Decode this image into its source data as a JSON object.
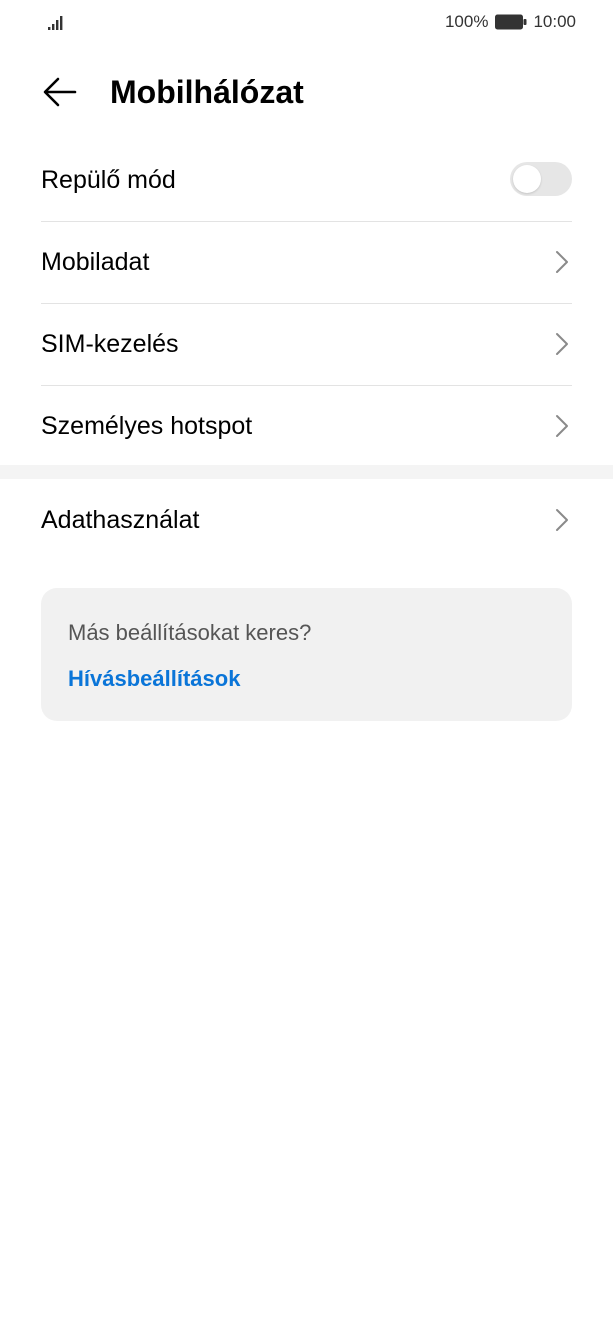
{
  "status_bar": {
    "signal_icon": "signal-icon",
    "battery_percent": "100%",
    "battery_icon": "battery-icon",
    "time": "10:00"
  },
  "header": {
    "back_icon": "arrow-left-icon",
    "title": "Mobilhálózat"
  },
  "settings": {
    "items": [
      {
        "label": "Repülő mód",
        "control": "toggle",
        "toggle_on": false
      },
      {
        "label": "Mobiladat",
        "control": "chevron"
      },
      {
        "label": "SIM-kezelés",
        "control": "chevron"
      },
      {
        "label": "Személyes hotspot",
        "control": "chevron"
      }
    ],
    "items2": [
      {
        "label": "Adathasználat",
        "control": "chevron"
      }
    ]
  },
  "suggestion_card": {
    "question": "Más beállításokat keres?",
    "link": "Hívásbeállítások"
  },
  "colors": {
    "accent": "#0a75d8",
    "toggle_off": "#e6e6e6",
    "card_bg": "#f1f1f1",
    "divider": "#e3e3e3"
  }
}
